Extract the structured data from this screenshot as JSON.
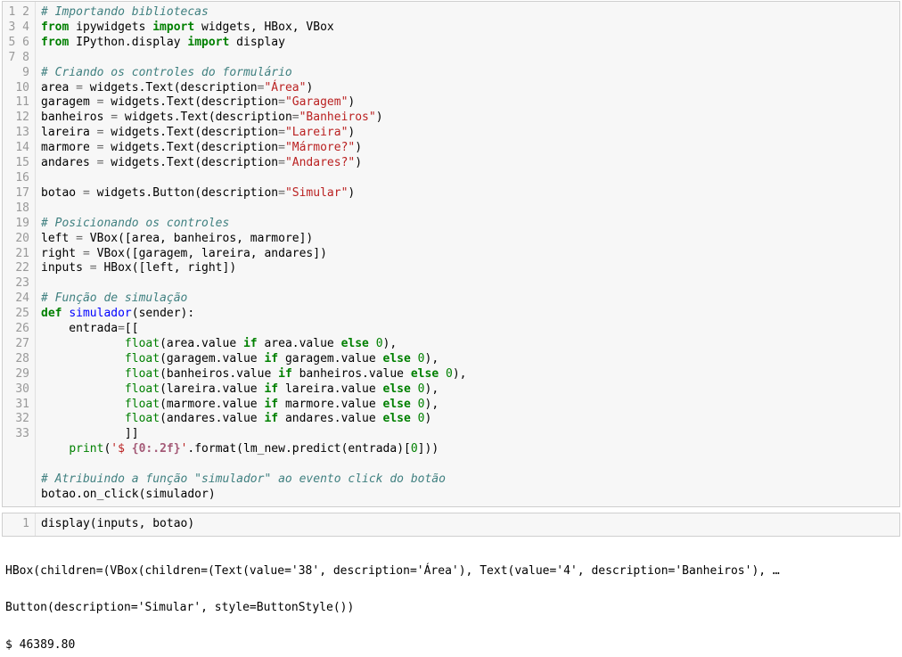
{
  "cell1": {
    "lines": [
      {
        "n": "1",
        "html": "<span class='tok-comment'># Importando bibliotecas</span>"
      },
      {
        "n": "2",
        "html": "<span class='tok-keyword'>from</span> ipywidgets <span class='tok-keyword'>import</span> widgets, HBox, VBox"
      },
      {
        "n": "3",
        "html": "<span class='tok-keyword'>from</span> IPython.display <span class='tok-keyword'>import</span> display"
      },
      {
        "n": "4",
        "html": ""
      },
      {
        "n": "5",
        "html": "<span class='tok-comment'># Criando os controles do formulário</span>"
      },
      {
        "n": "6",
        "html": "area <span class='tok-op'>=</span> widgets.Text(description<span class='tok-op'>=</span><span class='tok-string'>\"Área\"</span>)"
      },
      {
        "n": "7",
        "html": "garagem <span class='tok-op'>=</span> widgets.Text(description<span class='tok-op'>=</span><span class='tok-string'>\"Garagem\"</span>)"
      },
      {
        "n": "8",
        "html": "banheiros <span class='tok-op'>=</span> widgets.Text(description<span class='tok-op'>=</span><span class='tok-string'>\"Banheiros\"</span>)"
      },
      {
        "n": "9",
        "html": "lareira <span class='tok-op'>=</span> widgets.Text(description<span class='tok-op'>=</span><span class='tok-string'>\"Lareira\"</span>)"
      },
      {
        "n": "10",
        "html": "marmore <span class='tok-op'>=</span> widgets.Text(description<span class='tok-op'>=</span><span class='tok-string'>\"Mármore?\"</span>)"
      },
      {
        "n": "11",
        "html": "andares <span class='tok-op'>=</span> widgets.Text(description<span class='tok-op'>=</span><span class='tok-string'>\"Andares?\"</span>)"
      },
      {
        "n": "12",
        "html": ""
      },
      {
        "n": "13",
        "html": "botao <span class='tok-op'>=</span> widgets.Button(description<span class='tok-op'>=</span><span class='tok-string'>\"Simular\"</span>)"
      },
      {
        "n": "14",
        "html": ""
      },
      {
        "n": "15",
        "html": "<span class='tok-comment'># Posicionando os controles</span>"
      },
      {
        "n": "16",
        "html": "left <span class='tok-op'>=</span> VBox([area, banheiros, marmore])"
      },
      {
        "n": "17",
        "html": "right <span class='tok-op'>=</span> VBox([garagem, lareira, andares])"
      },
      {
        "n": "18",
        "html": "inputs <span class='tok-op'>=</span> HBox([left, right])"
      },
      {
        "n": "19",
        "html": ""
      },
      {
        "n": "20",
        "html": "<span class='tok-comment'># Função de simulação</span>"
      },
      {
        "n": "21",
        "html": "<span class='tok-keyword'>def</span> <span class='tok-func'>simulador</span>(sender):"
      },
      {
        "n": "22",
        "html": "    entrada<span class='tok-op'>=</span>[["
      },
      {
        "n": "23",
        "html": "            <span class='tok-builtin'>float</span>(area.value <span class='tok-keyword'>if</span> area.value <span class='tok-keyword'>else</span> <span class='tok-number'>0</span>),"
      },
      {
        "n": "24",
        "html": "            <span class='tok-builtin'>float</span>(garagem.value <span class='tok-keyword'>if</span> garagem.value <span class='tok-keyword'>else</span> <span class='tok-number'>0</span>),"
      },
      {
        "n": "25",
        "html": "            <span class='tok-builtin'>float</span>(banheiros.value <span class='tok-keyword'>if</span> banheiros.value <span class='tok-keyword'>else</span> <span class='tok-number'>0</span>),"
      },
      {
        "n": "26",
        "html": "            <span class='tok-builtin'>float</span>(lareira.value <span class='tok-keyword'>if</span> lareira.value <span class='tok-keyword'>else</span> <span class='tok-number'>0</span>),"
      },
      {
        "n": "27",
        "html": "            <span class='tok-builtin'>float</span>(marmore.value <span class='tok-keyword'>if</span> marmore.value <span class='tok-keyword'>else</span> <span class='tok-number'>0</span>),"
      },
      {
        "n": "28",
        "html": "            <span class='tok-builtin'>float</span>(andares.value <span class='tok-keyword'>if</span> andares.value <span class='tok-keyword'>else</span> <span class='tok-number'>0</span>)"
      },
      {
        "n": "29",
        "html": "            ]]"
      },
      {
        "n": "30",
        "html": "    <span class='tok-builtin'>print</span>(<span class='tok-string'>'$ </span><span style='color:#a45a77;font-weight:bold'>{0:.2f}</span><span class='tok-string'>'</span>.format(lm_new.predict(entrada)[<span class='tok-number'>0</span>]))"
      },
      {
        "n": "31",
        "html": ""
      },
      {
        "n": "32",
        "html": "<span class='tok-comment'># Atribuindo a função \"simulador\" ao evento click do botão</span>"
      },
      {
        "n": "33",
        "html": "botao.on_click(simulador)"
      }
    ]
  },
  "cell2": {
    "lines": [
      {
        "n": "1",
        "html": "display(inputs, botao)"
      }
    ]
  },
  "output": {
    "line1": "HBox(children=(VBox(children=(Text(value='38', description='Área'), Text(value='4', description='Banheiros'), …",
    "line2": "Button(description='Simular', style=ButtonStyle())",
    "line3": "$ 46389.80"
  }
}
